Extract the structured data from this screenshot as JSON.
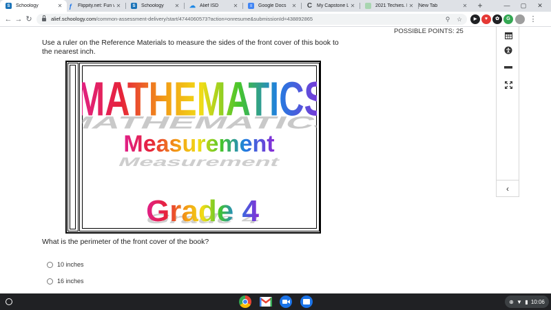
{
  "tabs": [
    {
      "title": "Schoology",
      "favicon": "schoology-icon",
      "color": "#1a73b8",
      "active": true
    },
    {
      "title": "Flippity.net: Fun w",
      "favicon": "flippity-icon",
      "color": "#1a73e8",
      "active": false
    },
    {
      "title": "Schoology",
      "favicon": "schoology-icon",
      "color": "#1a73b8",
      "active": false
    },
    {
      "title": "Alief ISD",
      "favicon": "alief-icon",
      "color": "#1e88e5",
      "active": false
    },
    {
      "title": "Google Docs",
      "favicon": "docs-icon",
      "color": "#4285f4",
      "active": false
    },
    {
      "title": "My Capstone Libr",
      "favicon": "capstone-icon",
      "color": "#5f6368",
      "active": false
    },
    {
      "title": "2021 Techies. Ma",
      "favicon": "techies-icon",
      "color": "#34a853",
      "active": false
    },
    {
      "title": "New Tab",
      "favicon": "",
      "color": "#dee1e6",
      "active": false
    }
  ],
  "address": {
    "host": "alief.schoology.com",
    "path": "/common-assessment-delivery/start/4744060573?action=onresume&submissionId=438892865"
  },
  "extensions": [
    {
      "name": "extension-icon-1",
      "color": "#202124",
      "glyph": "▶"
    },
    {
      "name": "extension-icon-2",
      "color": "#e53935",
      "glyph": "♥"
    },
    {
      "name": "extension-icon-3",
      "color": "#202124",
      "glyph": "✿"
    },
    {
      "name": "extension-icon-4",
      "color": "#34a853",
      "glyph": "G"
    },
    {
      "name": "extension-icon-5",
      "color": "#9e9e9e",
      "glyph": "⋯"
    }
  ],
  "assessment": {
    "points_label": "POSSIBLE POINTS: 25",
    "prompt": "Use a ruler on the Reference Materials to measure the sides of the front cover of this book to the nearest inch.",
    "cover_title": "MATHEMATICS",
    "cover_subtitle": "Measurement",
    "cover_grade": "Grade 4",
    "question": "What is the perimeter of the front cover of the book?",
    "choices": [
      "10 inches",
      "16 inches"
    ]
  },
  "tools": [
    {
      "name": "calendar-icon"
    },
    {
      "name": "accessibility-icon"
    },
    {
      "name": "line-reader-icon"
    },
    {
      "name": "fullscreen-icon"
    }
  ],
  "shelf": {
    "apps": [
      "chrome-icon",
      "gmail-icon",
      "meet-icon",
      "files-icon"
    ],
    "time": "10:06"
  }
}
